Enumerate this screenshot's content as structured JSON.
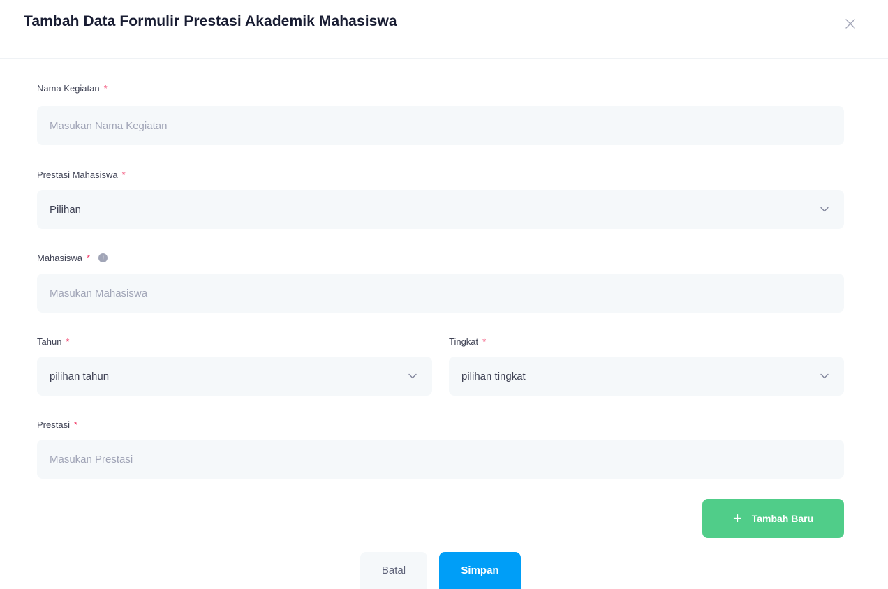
{
  "modal": {
    "title": "Tambah Data Formulir Prestasi Akademik Mahasiswa",
    "close_icon": "close-icon"
  },
  "required_marker": "*",
  "info_marker": "!",
  "fields": {
    "nama_kegiatan": {
      "label": "Nama Kegiatan",
      "placeholder": "Masukan Nama Kegiatan",
      "value": ""
    },
    "prestasi_mahasiswa": {
      "label": "Prestasi Mahasiswa",
      "selected": "Pilihan"
    },
    "mahasiswa": {
      "label": "Mahasiswa",
      "placeholder": "Masukan Mahasiswa",
      "value": "",
      "info_icon": "info-icon"
    },
    "tahun": {
      "label": "Tahun",
      "selected": "pilihan tahun"
    },
    "tingkat": {
      "label": "Tingkat",
      "selected": "pilihan tingkat"
    },
    "prestasi": {
      "label": "Prestasi",
      "placeholder": "Masukan Prestasi",
      "value": ""
    }
  },
  "buttons": {
    "add_new": {
      "icon": "plus-icon",
      "label": "Tambah Baru"
    },
    "cancel": {
      "label": "Batal"
    },
    "save": {
      "label": "Simpan"
    }
  },
  "colors": {
    "required": "#f1416c",
    "add_button": "#50cd89",
    "save_button": "#009ef7",
    "input_background": "#f5f8fa"
  }
}
